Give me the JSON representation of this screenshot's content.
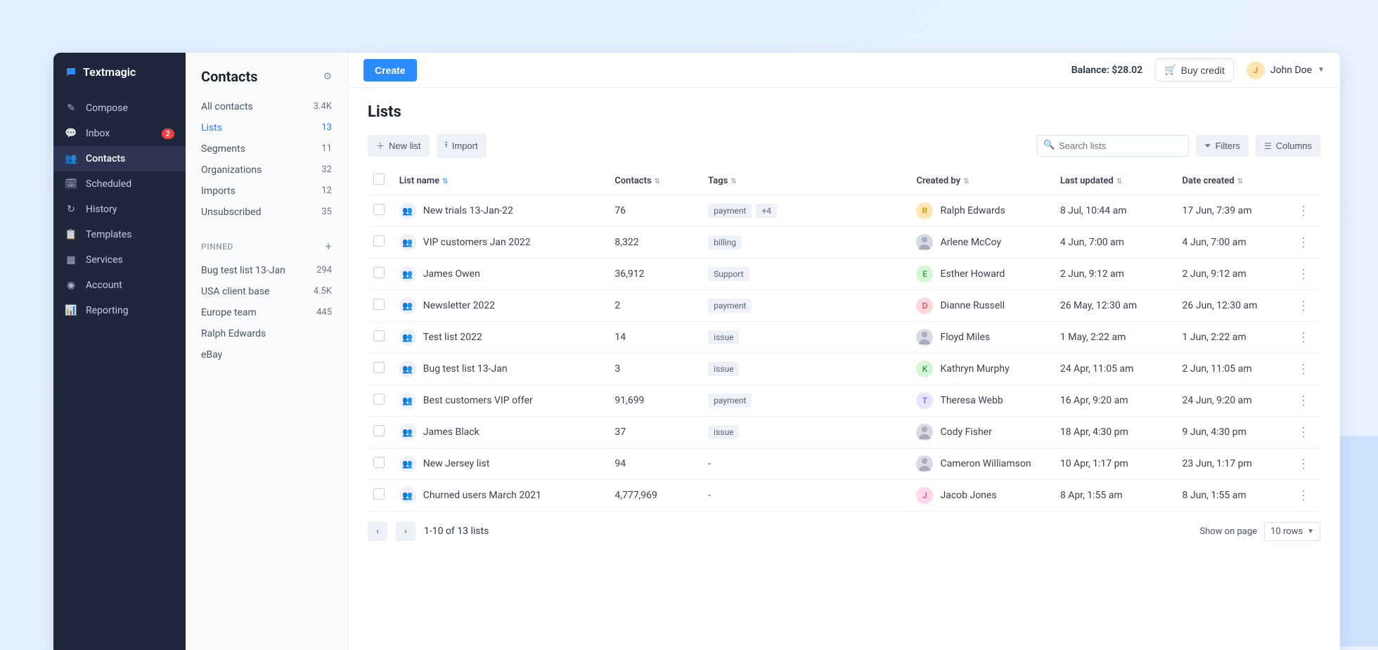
{
  "brand": "Textmagic",
  "topbar": {
    "create": "Create",
    "balance_label": "Balance: $28.02",
    "buy_credit": "Buy credit",
    "user_name": "John Doe",
    "user_initial": "J"
  },
  "nav": [
    {
      "icon": "✎",
      "label": "Compose"
    },
    {
      "icon": "💬",
      "label": "Inbox",
      "badge": "2"
    },
    {
      "icon": "👥",
      "label": "Contacts",
      "active": true
    },
    {
      "icon": "🗓",
      "label": "Scheduled"
    },
    {
      "icon": "↻",
      "label": "History"
    },
    {
      "icon": "📋",
      "label": "Templates"
    },
    {
      "icon": "▦",
      "label": "Services"
    },
    {
      "icon": "◉",
      "label": "Account"
    },
    {
      "icon": "📊",
      "label": "Reporting"
    }
  ],
  "subpanel": {
    "title": "Contacts",
    "items": [
      {
        "label": "All contacts",
        "count": "3.4K"
      },
      {
        "label": "Lists",
        "count": "13",
        "active": true
      },
      {
        "label": "Segments",
        "count": "11"
      },
      {
        "label": "Organizations",
        "count": "32"
      },
      {
        "label": "Imports",
        "count": "12"
      },
      {
        "label": "Unsubscribed",
        "count": "35"
      }
    ],
    "pinned_header": "PINNED",
    "pinned": [
      {
        "label": "Bug test list 13-Jan",
        "count": "294"
      },
      {
        "label": "USA client base",
        "count": "4.5K"
      },
      {
        "label": "Europe team",
        "count": "445"
      },
      {
        "label": "Ralph Edwards",
        "count": ""
      },
      {
        "label": "eBay",
        "count": ""
      }
    ]
  },
  "page": {
    "heading": "Lists",
    "new_list": "New list",
    "import": "Import",
    "search_placeholder": "Search lists",
    "filters": "Filters",
    "columns": "Columns"
  },
  "table": {
    "headers": {
      "name": "List name",
      "contacts": "Contacts",
      "tags": "Tags",
      "created_by": "Created by",
      "updated": "Last updated",
      "created": "Date created"
    },
    "rows": [
      {
        "name": "New trials 13-Jan-22",
        "contacts": "76",
        "tags": [
          "payment",
          "+4"
        ],
        "creator": "Ralph Edwards",
        "initial": "R",
        "color": "#ffe6b3",
        "textcolor": "#d89a00",
        "updated": "8 Jul, 10:44 am",
        "created": "17 Jun, 7:39 am"
      },
      {
        "name": "VIP customers Jan 2022",
        "contacts": "8,322",
        "tags": [
          "billing"
        ],
        "creator": "Arlene McCoy",
        "img": true,
        "updated": "4 Jun, 7:00 am",
        "created": "4 Jun, 7:00 am"
      },
      {
        "name": "James Owen",
        "contacts": "36,912",
        "tags": [
          "Support"
        ],
        "creator": "Esther Howard",
        "initial": "E",
        "color": "#d6f6d6",
        "textcolor": "#3ba55c",
        "updated": "2 Jun, 9:12 am",
        "created": "2 Jun, 9:12 am"
      },
      {
        "name": "Newsletter 2022",
        "contacts": "2",
        "tags": [
          "payment"
        ],
        "creator": "Dianne Russell",
        "initial": "D",
        "color": "#ffd9dd",
        "textcolor": "#e05260",
        "updated": "26 May, 12:30 am",
        "created": "26 Jun, 12:30 am"
      },
      {
        "name": "Test list 2022",
        "contacts": "14",
        "tags": [
          "issue"
        ],
        "creator": "Floyd Miles",
        "img": true,
        "updated": "1 May, 2:22 am",
        "created": "1 Jun, 2:22 am"
      },
      {
        "name": "Bug test list 13-Jan",
        "contacts": "3",
        "tags": [
          "issue"
        ],
        "creator": "Kathryn Murphy",
        "initial": "K",
        "color": "#d6f6d6",
        "textcolor": "#3ba55c",
        "updated": "24 Apr, 11:05 am",
        "created": "2 Jun, 11:05 am"
      },
      {
        "name": "Best customers VIP offer",
        "contacts": "91,699",
        "tags": [
          "payment"
        ],
        "creator": "Theresa Webb",
        "initial": "T",
        "color": "#e8e3ff",
        "textcolor": "#7c6fe0",
        "updated": "16 Apr, 9:20 am",
        "created": "24 Jun, 9:20 am"
      },
      {
        "name": "James Black",
        "contacts": "37",
        "tags": [
          "issue"
        ],
        "creator": "Cody Fisher",
        "img": true,
        "updated": "18 Apr, 4:30 pm",
        "created": "9 Jun, 4:30 pm"
      },
      {
        "name": "New Jersey list",
        "contacts": "94",
        "tags": [
          "-"
        ],
        "plain": true,
        "creator": "Cameron Williamson",
        "img": true,
        "updated": "10 Apr, 1:17 pm",
        "created": "23 Jun, 1:17 pm"
      },
      {
        "name": "Churned users March 2021",
        "contacts": "4,777,969",
        "tags": [
          "-"
        ],
        "plain": true,
        "creator": "Jacob Jones",
        "initial": "J",
        "color": "#ffd9e8",
        "textcolor": "#d85590",
        "updated": "8 Apr, 1:55 am",
        "created": "8 Jun, 1:55 am"
      }
    ]
  },
  "pager": {
    "summary": "1-10 of 13 lists",
    "show_label": "Show on page",
    "rows_label": "10 rows"
  }
}
